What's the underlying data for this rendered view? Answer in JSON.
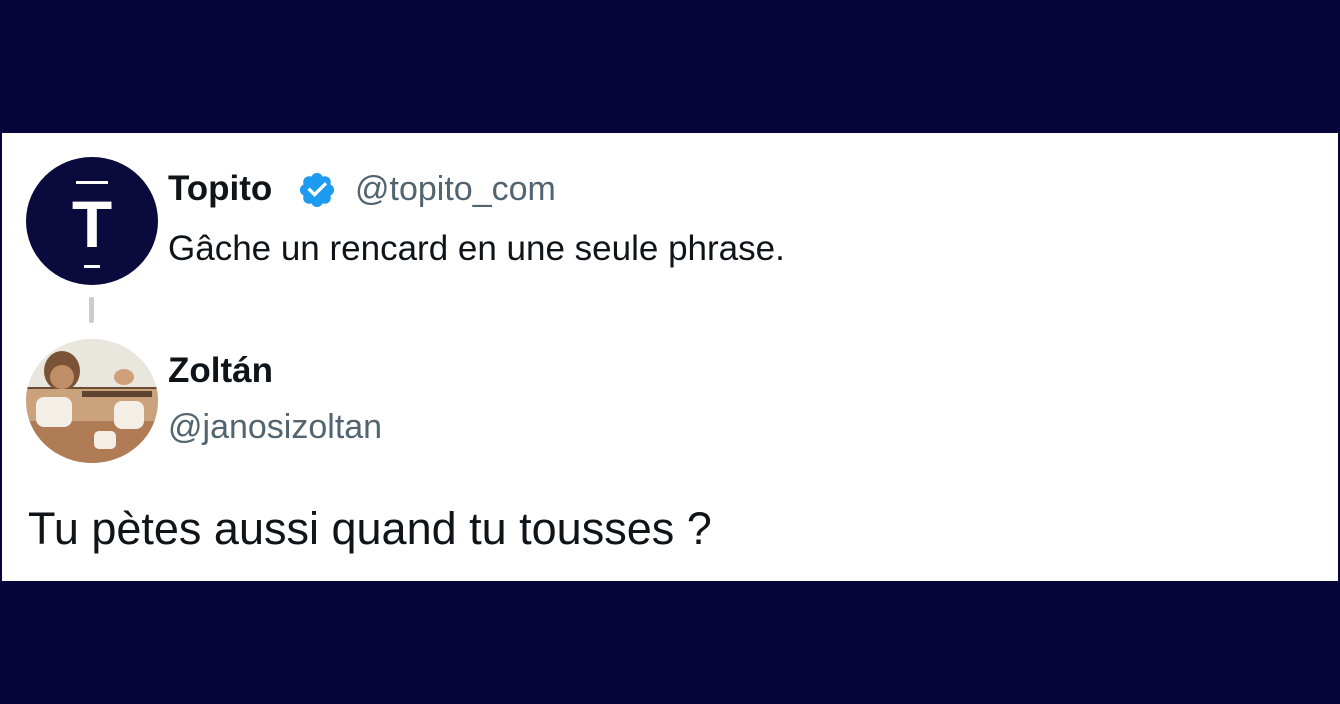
{
  "colors": {
    "background": "#06043a",
    "card": "#ffffff",
    "verified_blue": "#1d9bf0",
    "text_primary": "#0f1419",
    "text_secondary": "#536471"
  },
  "original_tweet": {
    "author_name": "Topito",
    "verified": true,
    "verified_icon": "verified-badge-icon",
    "handle": "@topito_com",
    "text": "Gâche un rencard en une seule phrase.",
    "avatar_letter": "T"
  },
  "reply": {
    "author_name": "Zoltán",
    "handle": "@janosizoltan",
    "text": "Tu pètes aussi quand tu tousses ?"
  }
}
